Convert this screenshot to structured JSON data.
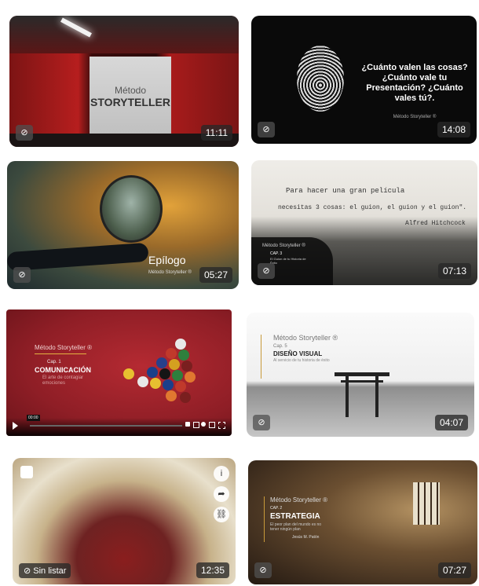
{
  "cards": [
    {
      "id": 1,
      "duration": "11:11",
      "brand_top": "Método",
      "brand_main": "STORYTELLER"
    },
    {
      "id": 2,
      "duration": "14:08",
      "question": "¿Cuánto valen las cosas? ¿Cuánto vale tu Presentación? ¿Cuánto vales tú?.",
      "brand": "Método Storyteller ®"
    },
    {
      "id": 3,
      "duration": "05:27",
      "title": "Epílogo",
      "brand": "Método Storyteller ®"
    },
    {
      "id": 4,
      "duration": "07:13",
      "quote_line1": "Para hacer una gran película",
      "quote_line2": "necesitas 3 cosas: el guion, el guion y el guion\".",
      "quote_author": "Alfred Hitchcock",
      "brand": "Método Storyteller ®",
      "cap": "CAP. 3",
      "cap_sub": "El Guion de tu Historia de Éxito"
    },
    {
      "id": 5,
      "brand": "Método Storyteller ®",
      "cap": "Cap. 1",
      "title": "COMUNICACIÓN",
      "subtitle": "El arte de contagiar emociones",
      "time_tooltip": "00:00"
    },
    {
      "id": 6,
      "duration": "04:07",
      "brand": "Método Storyteller ®",
      "cap": "Cap. 5",
      "title": "DISEÑO VISUAL",
      "subtitle": "Al servicio de tu historia de éxito"
    },
    {
      "id": 7,
      "duration": "12:35",
      "status": "Sin listar"
    },
    {
      "id": 8,
      "duration": "07:27",
      "brand": "Método Storyteller ®",
      "cap": "CAP. 2",
      "title": "ESTRATEGIA",
      "subtitle": "El peor plan del mundo es no tener ningún plan",
      "author": "Jesús M. Patón"
    }
  ]
}
